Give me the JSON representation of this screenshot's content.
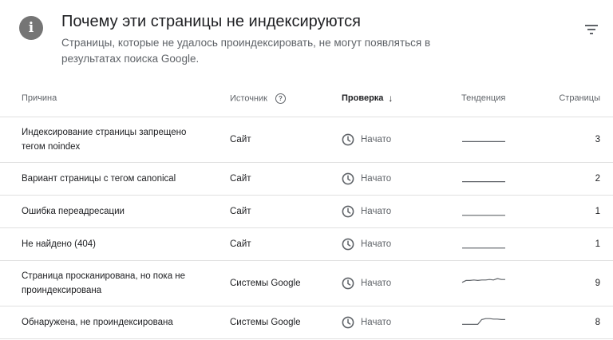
{
  "header": {
    "info_glyph": "i",
    "title": "Почему эти страницы не индексируются",
    "subtitle": "Страницы, которые не удалось проиндексировать, не могут появляться в результатах поиска Google."
  },
  "table": {
    "columns": {
      "cause": "Причина",
      "source": "Источник",
      "check": "Проверка",
      "trend": "Тенденция",
      "pages": "Страницы"
    },
    "sort_column": "Проверка",
    "rows": [
      {
        "cause": "Индексирование страницы запрещено тегом noindex",
        "source": "Сайт",
        "check": "Начато",
        "trend": [
          3,
          3,
          3,
          3,
          3,
          3,
          3,
          3,
          3,
          3
        ],
        "pages": "3"
      },
      {
        "cause": "Вариант страницы с тегом canonical",
        "source": "Сайт",
        "check": "Начато",
        "trend": [
          2,
          2,
          2,
          2,
          2,
          2,
          2,
          2,
          2,
          2
        ],
        "pages": "2"
      },
      {
        "cause": "Ошибка переадресации",
        "source": "Сайт",
        "check": "Начато",
        "trend": [
          1,
          1,
          1,
          1,
          1,
          1,
          1,
          1,
          1,
          1
        ],
        "pages": "1"
      },
      {
        "cause": "Не найдено (404)",
        "source": "Сайт",
        "check": "Начато",
        "trend": [
          1,
          1,
          1,
          1,
          1,
          1,
          1,
          1,
          1,
          1
        ],
        "pages": "1"
      },
      {
        "cause": "Страница просканирована, но пока не проиндексирована",
        "source": "Системы Google",
        "check": "Начато",
        "trend": [
          6,
          8,
          8,
          8.5,
          8,
          8.5,
          8.5,
          9,
          8.5,
          10,
          9,
          9
        ],
        "pages": "9"
      },
      {
        "cause": "Обнаружена, не проиндексирована",
        "source": "Системы Google",
        "check": "Начато",
        "trend": [
          3,
          3,
          3,
          3,
          3,
          8,
          9,
          9,
          8.5,
          8.5,
          8,
          8
        ],
        "pages": "8"
      }
    ]
  },
  "icons": {
    "info": "info-icon",
    "filter": "filter-icon",
    "help": "help-circle-icon",
    "sort": "arrow-down-icon",
    "status": "clock-icon"
  },
  "colors": {
    "info_bg": "#757575",
    "muted_text": "#5f6368",
    "sparkline": "#5f6368",
    "divider": "#e0e0e0"
  }
}
